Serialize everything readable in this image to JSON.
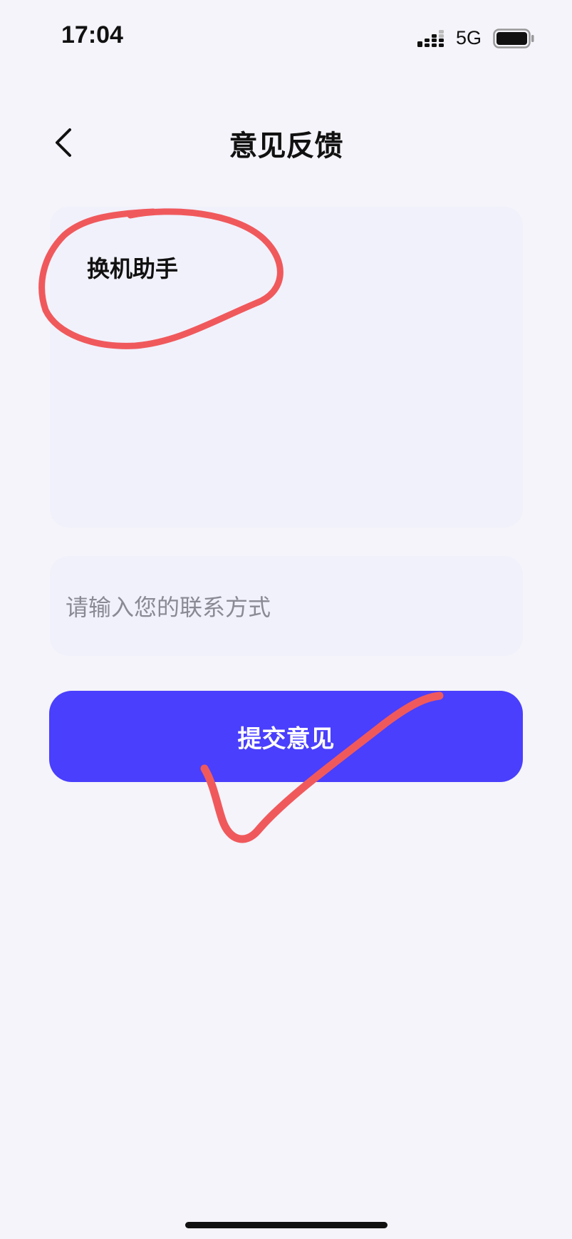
{
  "status_bar": {
    "time": "17:04",
    "network": "5G",
    "icons": [
      "signal-icon",
      "battery-icon"
    ]
  },
  "header": {
    "title": "意见反馈",
    "back_icon": "chevron-left-icon"
  },
  "form": {
    "feedback_value": "换机助手",
    "contact_placeholder": "请输入您的联系方式",
    "submit_label": "提交意见"
  },
  "colors": {
    "background": "#f4f4fa",
    "field_background": "#f1f1fb",
    "accent": "#4a3ffc",
    "annotation": "#f0595c"
  }
}
